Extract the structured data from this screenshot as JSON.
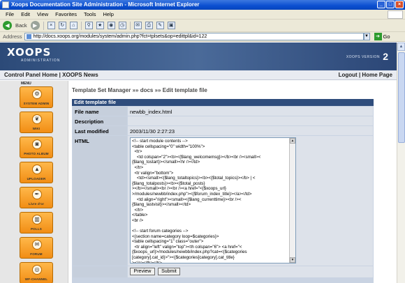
{
  "window": {
    "title": "Xoops Documentation Site Administration - Microsoft Internet Explorer"
  },
  "menubar": [
    "File",
    "Edit",
    "View",
    "Favorites",
    "Tools",
    "Help"
  ],
  "toolbar": {
    "back_label": "Back",
    "go_label": "Go"
  },
  "address": {
    "label": "Address",
    "url": "http://docs.xoops.org/modules/system/admin.php?fct=tplsets&op=edittpl&id=122"
  },
  "banner": {
    "logo": "XOOPS",
    "logo_sub": "ADMINISTRATION",
    "version_label": "XOOPS VERSION",
    "version_num": "2"
  },
  "nav": {
    "control_panel": "Control Panel Home",
    "sep": " | ",
    "news": "XOOPS News",
    "logout": "Logout",
    "home": "Home Page"
  },
  "sidebar": {
    "title": "MENU",
    "modules": [
      {
        "label": "SYSTEM ADMIN",
        "icon": "gear-icon"
      },
      {
        "label": "WIKI",
        "icon": "book-icon"
      },
      {
        "label": "PHOTO ALBUM",
        "icon": "camera-icon"
      },
      {
        "label": "UPLOADER",
        "icon": "upload-icon"
      },
      {
        "label": "Livre d'or",
        "icon": "pen-icon"
      },
      {
        "label": "POLLS",
        "icon": "chart-icon"
      },
      {
        "label": "FORUM",
        "icon": "speech-icon"
      },
      {
        "label": "WF-CHANNEL",
        "icon": "channel-icon"
      }
    ]
  },
  "breadcrumb": {
    "root": "Template Set Manager",
    "sep": "»»",
    "mid": "docs",
    "current": "Edit template file"
  },
  "form": {
    "header": "Edit template file",
    "rows": [
      {
        "label": "File name",
        "value": "newbb_index.html"
      },
      {
        "label": "Description",
        "value": ""
      },
      {
        "label": "Last modified",
        "value": "2003/11/30 2:27:23"
      }
    ],
    "html_label": "HTML",
    "html_code": "<!-- start module contents -->\n<table cellspacing=\"0\" width=\"100%\">\n  <tr>\n    <td colspan=\"2\"><b><{$lang_welcomemsg}></b><br /><small><\n{$lang_tostart}></small><hr /></td>\n  </tr>\n  <tr valign=\"bottom\">\n    <td><small><{$lang_totaltopics}><b><{$total_topics}></b> | <\n{$lang_totalposts}><b><{$total_posts}\n></b></small><br /><br /><a href=\"<{$xoops_url}\n>/modules/newbb/index.php\"><{$forum_index_title}></a></td>\n    <td align=\"right\"><small><{$lang_currenttime}><br /><\n{$lang_lastvisit}></small></td>\n  </tr>\n</table>\n<br />\n\n<!-- start forum categories -->\n<{section name=category loop=$categories}>\n<table cellspacing=\"1\" class=\"outer\">\n  <tr align=\"left\" valign=\"top\"><th colspan=\"6\"> <a href=\"<\n{$xoops_url}>/modules/newbb/index.php?cat=<{$categories\n[category].cat_id}>\"><{$categories[category].cat_title}\n></a></th></tr>\n  <tr class=\"head\" align=\"center\">",
    "preview_label": "Preview",
    "submit_label": "Submit"
  }
}
